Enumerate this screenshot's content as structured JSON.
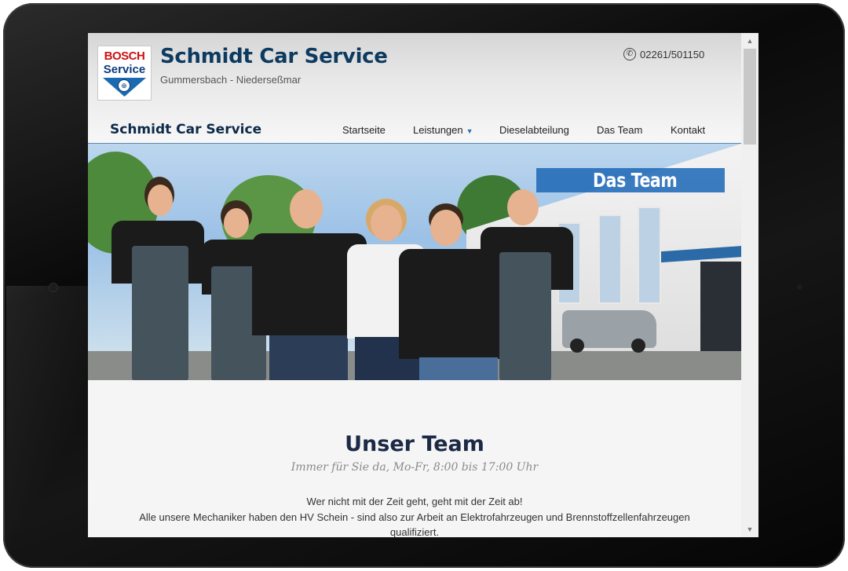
{
  "header": {
    "logo_line1": "BOSCH",
    "logo_line2": "Service",
    "title": "Schmidt Car Service",
    "subtitle": "Gummersbach - Niederseßmar",
    "phone": "02261/501150"
  },
  "nav": {
    "brand": "Schmidt Car Service",
    "items": [
      {
        "label": "Startseite"
      },
      {
        "label": "Leistungen",
        "has_dropdown": true
      },
      {
        "label": "Dieselabteilung"
      },
      {
        "label": "Das Team"
      },
      {
        "label": "Kontakt"
      }
    ]
  },
  "hero": {
    "banner": "Das Team"
  },
  "content": {
    "title": "Unser Team",
    "subtitle": "Immer für Sie da, Mo-Fr, 8:00 bis 17:00 Uhr",
    "line1": "Wer nicht mit der Zeit geht, geht mit der Zeit ab!",
    "line2": "Alle unsere Mechaniker haben den HV Schein - sind also zur Arbeit an Elektrofahrzeugen und Brennstoffzellenfahrzeugen",
    "line3": "qualifiziert."
  },
  "colors": {
    "title_blue": "#0d3a5f",
    "accent_blue": "#2e6db4",
    "banner_blue": "#216ab7",
    "heading_dark": "#1c2a46"
  },
  "icons": {
    "phone": "phone-icon",
    "scroll_up": "scroll-up-icon",
    "scroll_down": "scroll-down-icon",
    "dropdown": "caret-down-icon"
  }
}
